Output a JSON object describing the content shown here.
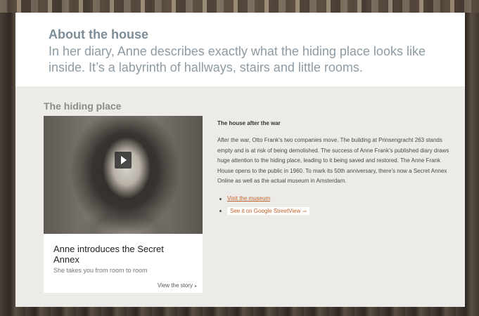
{
  "header": {
    "title": "About the house",
    "intro": "In her diary, Anne describes exactly what the hiding place looks like inside. It’s a labyrinth of hallways, stairs and little rooms."
  },
  "section": {
    "title": "The hiding place"
  },
  "video_card": {
    "title": "Anne introduces the Secret Annex",
    "subtitle": "She takes you from room to room",
    "link_label": "View the story",
    "link_icon": "▸"
  },
  "article": {
    "title": "The house after the war",
    "body": "After the war, Otto Frank’s two companies move. The building at Prinsengracht 263 stands empty and is at risk of being demolished. The success of Anne Frank’s published diary draws huge attention to the hiding place, leading to it being saved and restored. The Anne Frank House opens to the public in 1960. To mark its 50th anniversary, there’s now a Secret Annex Online as well as the actual museum in Amsterdam.",
    "links": [
      {
        "label": "Visit the museum"
      },
      {
        "label": "See it on Google StreetView",
        "icon": "external-link-icon"
      }
    ]
  },
  "colors": {
    "link": "#c2632a",
    "heading": "#7d8d98",
    "content_bg": "#edebe8"
  }
}
